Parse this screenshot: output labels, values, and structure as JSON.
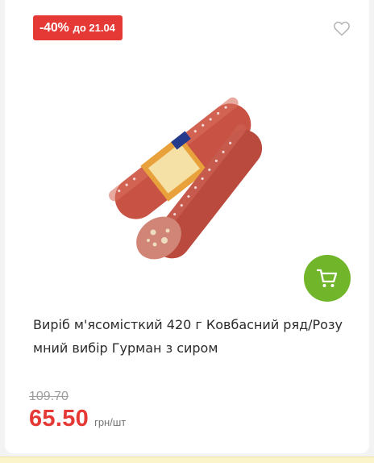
{
  "card": {
    "discount": {
      "percent": "-40%",
      "until": "до 21.04",
      "color": "#e53935"
    },
    "favorite_icon": "heart-outline-icon",
    "cart_icon": "cart-icon",
    "cart_color": "#71b52a",
    "title": "Виріб м'ясомісткий 420 г Ковбасний ряд/Розумний вибір Гурман з сиром",
    "price": {
      "old": "109.70",
      "current": "65.50",
      "unit": "грн/шт",
      "accent": "#e53935"
    }
  }
}
